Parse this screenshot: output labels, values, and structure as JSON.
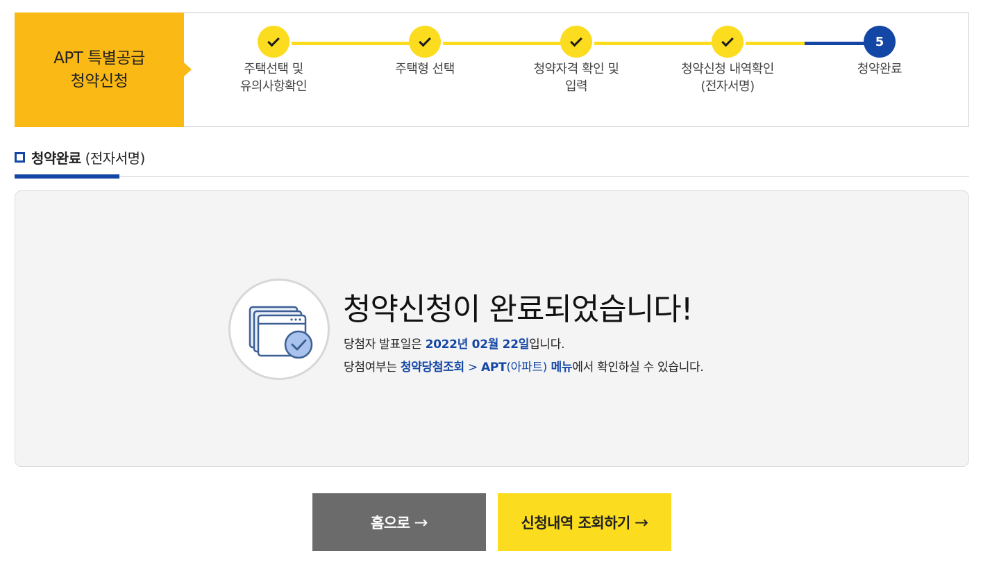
{
  "stepbar": {
    "title_line1": "APT 특별공급",
    "title_line2": "청약신청",
    "steps": [
      {
        "label_line1": "주택선택 및",
        "label_line2": "유의사항확인",
        "status": "done"
      },
      {
        "label_line1": "주택형 선택",
        "label_line2": "",
        "status": "done"
      },
      {
        "label_line1": "청약자격 확인 및",
        "label_line2": "입력",
        "status": "done"
      },
      {
        "label_line1": "청약신청 내역확인",
        "label_line2": "(전자서명)",
        "status": "done"
      },
      {
        "label_line1": "청약완료",
        "label_line2": "",
        "status": "current",
        "number": "5"
      }
    ]
  },
  "section": {
    "title_bold": "청약완료",
    "title_rest": "(전자서명)"
  },
  "message": {
    "title": "청약신청이 완료되었습니다!",
    "line1_prefix": "당첨자 발표일은 ",
    "line1_date": "2022년 02월 22일",
    "line1_suffix": "입니다.",
    "line2_prefix": "당첨여부는 ",
    "line2_link1": "청약당첨조회",
    "line2_sep": " > ",
    "line2_link2_bold": "APT",
    "line2_link2_paren": "(아파트)",
    "line2_link2_tail": " 메뉴",
    "line2_suffix": "에서 확인하실 수 있습니다."
  },
  "buttons": {
    "home_label": "홈으로",
    "history_label": "신청내역 조회하기",
    "arrow": "→"
  },
  "colors": {
    "accent_yellow": "#fcdc1e",
    "title_orange": "#fbb916",
    "primary_blue": "#1447a5",
    "button_gray": "#6b6b6b"
  },
  "icons": {
    "step_done": "check-icon",
    "complete_illustration": "browser-windows-check-icon"
  }
}
